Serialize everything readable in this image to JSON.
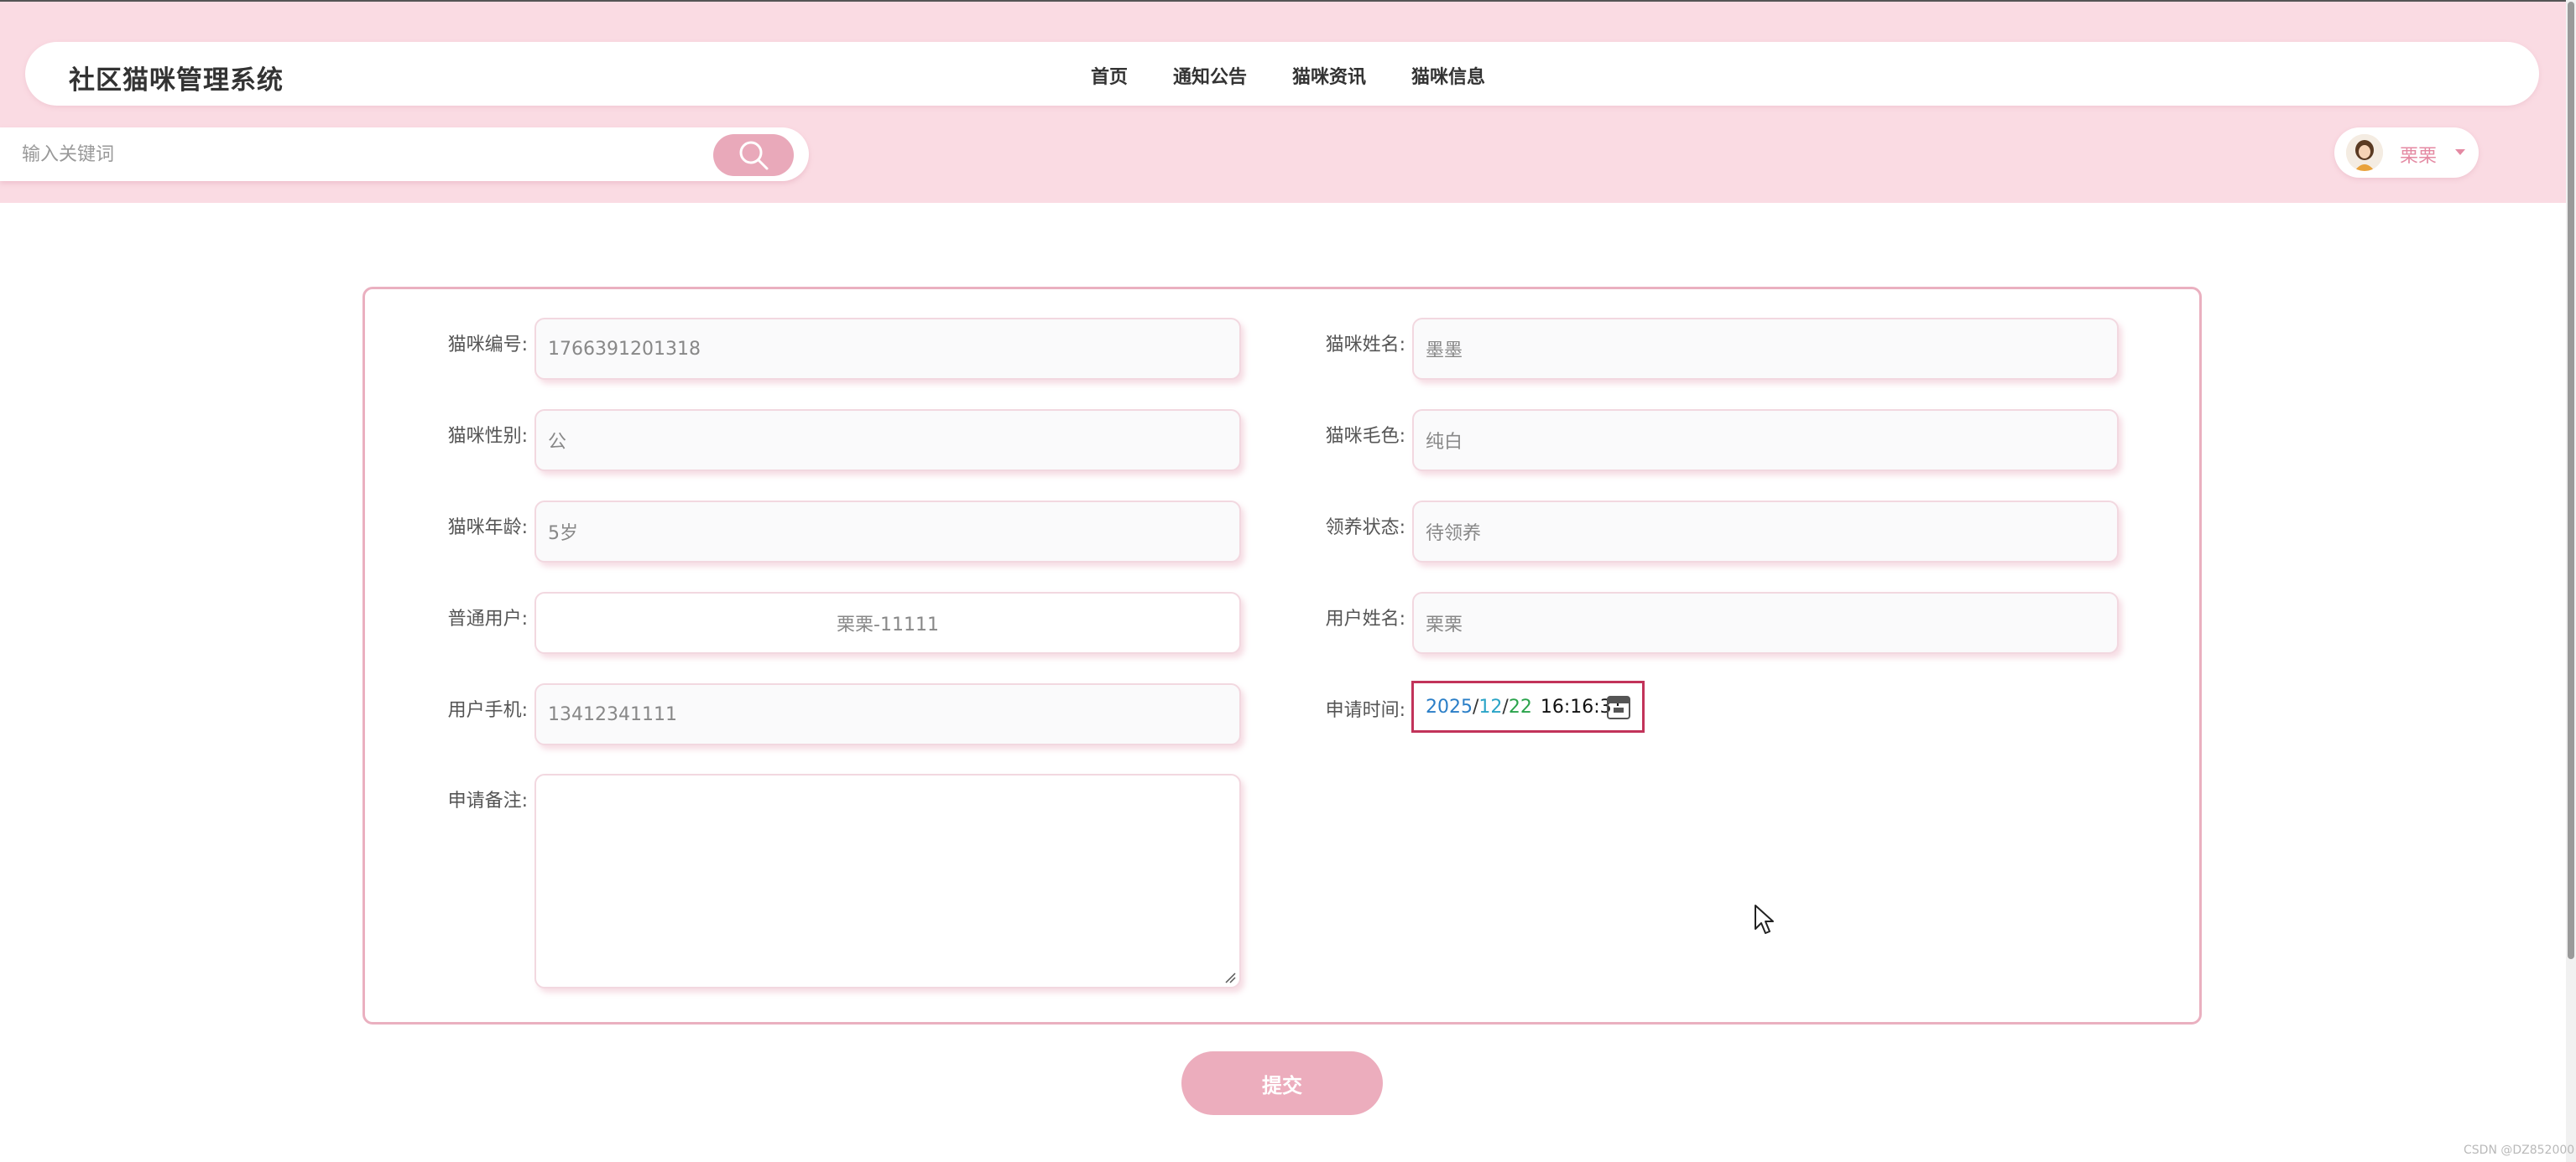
{
  "app": {
    "title": "社区猫咪管理系统"
  },
  "nav": {
    "items": [
      "首页",
      "通知公告",
      "猫咪资讯",
      "猫咪信息"
    ]
  },
  "search": {
    "placeholder": "输入关键词",
    "icon": "search-icon"
  },
  "user": {
    "name": "栗栗",
    "avatar_icon": "avatar-icon",
    "menu_icon": "caret-down-icon"
  },
  "form": {
    "cat_id": {
      "label": "猫咪编号:",
      "value": "1766391201318"
    },
    "cat_name": {
      "label": "猫咪姓名:",
      "value": "墨墨"
    },
    "cat_gender": {
      "label": "猫咪性别:",
      "value": "公"
    },
    "cat_color": {
      "label": "猫咪毛色:",
      "value": "纯白"
    },
    "cat_age": {
      "label": "猫咪年龄:",
      "value": "5岁"
    },
    "adopt_status": {
      "label": "领养状态:",
      "value": "待领养"
    },
    "regular_user": {
      "label": "普通用户:",
      "value": "栗栗-11111"
    },
    "user_name": {
      "label": "用户姓名:",
      "value": "栗栗"
    },
    "user_phone": {
      "label": "用户手机:",
      "value": "13412341111"
    },
    "apply_time": {
      "label": "申请时间:",
      "year": "2025",
      "month": "12",
      "day": "22",
      "sep": "/",
      "time": "16:16:31",
      "icon": "calendar-icon"
    },
    "apply_note": {
      "label": "申请备注:",
      "value": ""
    }
  },
  "submit": {
    "label": "提交"
  },
  "watermark": "CSDN @DZ852000",
  "colors": {
    "pink_band": "#fadbe3",
    "accent": "#e9a9ba",
    "submit": "#ecadbd",
    "card_border": "#eab0c0",
    "date_border": "#c2335a"
  }
}
